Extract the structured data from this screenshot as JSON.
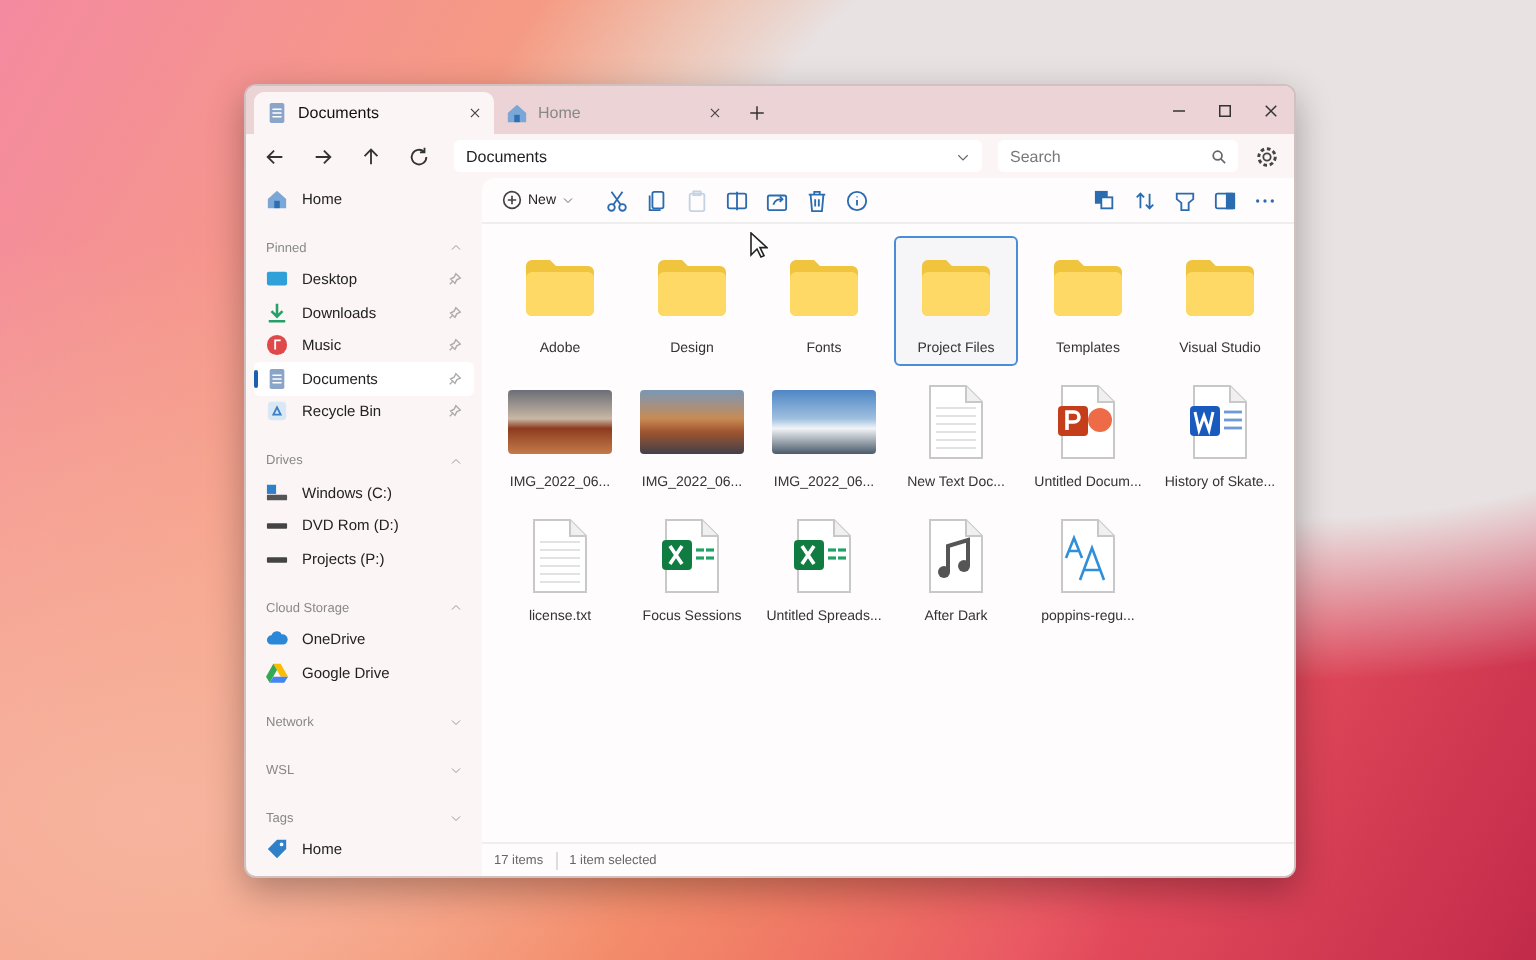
{
  "tabs": [
    {
      "label": "Documents",
      "kind": "documents",
      "selected": true
    },
    {
      "label": "Home",
      "kind": "home",
      "selected": false
    }
  ],
  "address": {
    "value": "Documents"
  },
  "search": {
    "placeholder": "Search"
  },
  "toolbar": {
    "new_label": "New",
    "actions": [
      {
        "kind": "cut",
        "disabled": false
      },
      {
        "kind": "copy",
        "disabled": false
      },
      {
        "kind": "paste",
        "disabled": true
      },
      {
        "kind": "rename",
        "disabled": false
      },
      {
        "kind": "share",
        "disabled": false
      },
      {
        "kind": "delete",
        "disabled": false
      },
      {
        "kind": "info",
        "disabled": false
      }
    ]
  },
  "sidebar": {
    "home": {
      "label": "Home"
    },
    "sections": [
      {
        "title": "Pinned",
        "expanded": true,
        "items": [
          {
            "label": "Desktop",
            "kind": "desktop",
            "selected": false,
            "pinned": true
          },
          {
            "label": "Downloads",
            "kind": "downloads",
            "selected": false,
            "pinned": true
          },
          {
            "label": "Music",
            "kind": "music",
            "selected": false,
            "pinned": true
          },
          {
            "label": "Documents",
            "kind": "documents",
            "selected": true,
            "pinned": true
          },
          {
            "label": "Recycle Bin",
            "kind": "recycle",
            "selected": false,
            "pinned": true
          }
        ]
      },
      {
        "title": "Drives",
        "expanded": true,
        "items": [
          {
            "label": "Windows (C:)",
            "kind": "system-drive",
            "selected": false,
            "pinned": false
          },
          {
            "label": "DVD Rom (D:)",
            "kind": "drive",
            "selected": false,
            "pinned": false
          },
          {
            "label": "Projects (P:)",
            "kind": "drive",
            "selected": false,
            "pinned": false
          }
        ]
      },
      {
        "title": "Cloud Storage",
        "expanded": true,
        "items": [
          {
            "label": "OneDrive",
            "kind": "cloud",
            "selected": false,
            "pinned": false
          },
          {
            "label": "Google Drive",
            "kind": "gdrive",
            "selected": false,
            "pinned": false
          }
        ]
      },
      {
        "title": "Network",
        "expanded": false
      },
      {
        "title": "WSL",
        "expanded": false
      },
      {
        "title": "Tags",
        "expanded": false,
        "items": [
          {
            "label": "Home",
            "kind": "tag",
            "selected": false,
            "pinned": false
          }
        ]
      }
    ]
  },
  "files": [
    {
      "name": "Adobe",
      "kind": "folder",
      "selected": false
    },
    {
      "name": "Design",
      "kind": "folder",
      "selected": false
    },
    {
      "name": "Fonts",
      "kind": "folder",
      "selected": false
    },
    {
      "name": "Project Files",
      "kind": "folder",
      "selected": true
    },
    {
      "name": "Templates",
      "kind": "folder",
      "selected": false
    },
    {
      "name": "Visual Studio",
      "kind": "folder",
      "selected": false
    },
    {
      "name": "IMG_2022_06...",
      "kind": "photo",
      "selected": false
    },
    {
      "name": "IMG_2022_06...",
      "kind": "photo",
      "selected": false
    },
    {
      "name": "IMG_2022_06...",
      "kind": "photo",
      "selected": false
    },
    {
      "name": "New Text Doc...",
      "kind": "text",
      "selected": false
    },
    {
      "name": "Untitled Docum...",
      "kind": "powerpoint",
      "selected": false
    },
    {
      "name": "History of Skate...",
      "kind": "word",
      "selected": false
    },
    {
      "name": "license.txt",
      "kind": "text",
      "selected": false
    },
    {
      "name": "Focus Sessions",
      "kind": "excel",
      "selected": false
    },
    {
      "name": "Untitled Spreads...",
      "kind": "excel",
      "selected": false
    },
    {
      "name": "After Dark",
      "kind": "music",
      "selected": false
    },
    {
      "name": "poppins-regu...",
      "kind": "font",
      "selected": false
    }
  ],
  "status_bar": {
    "count": "17 items",
    "selection": "1 item selected"
  }
}
